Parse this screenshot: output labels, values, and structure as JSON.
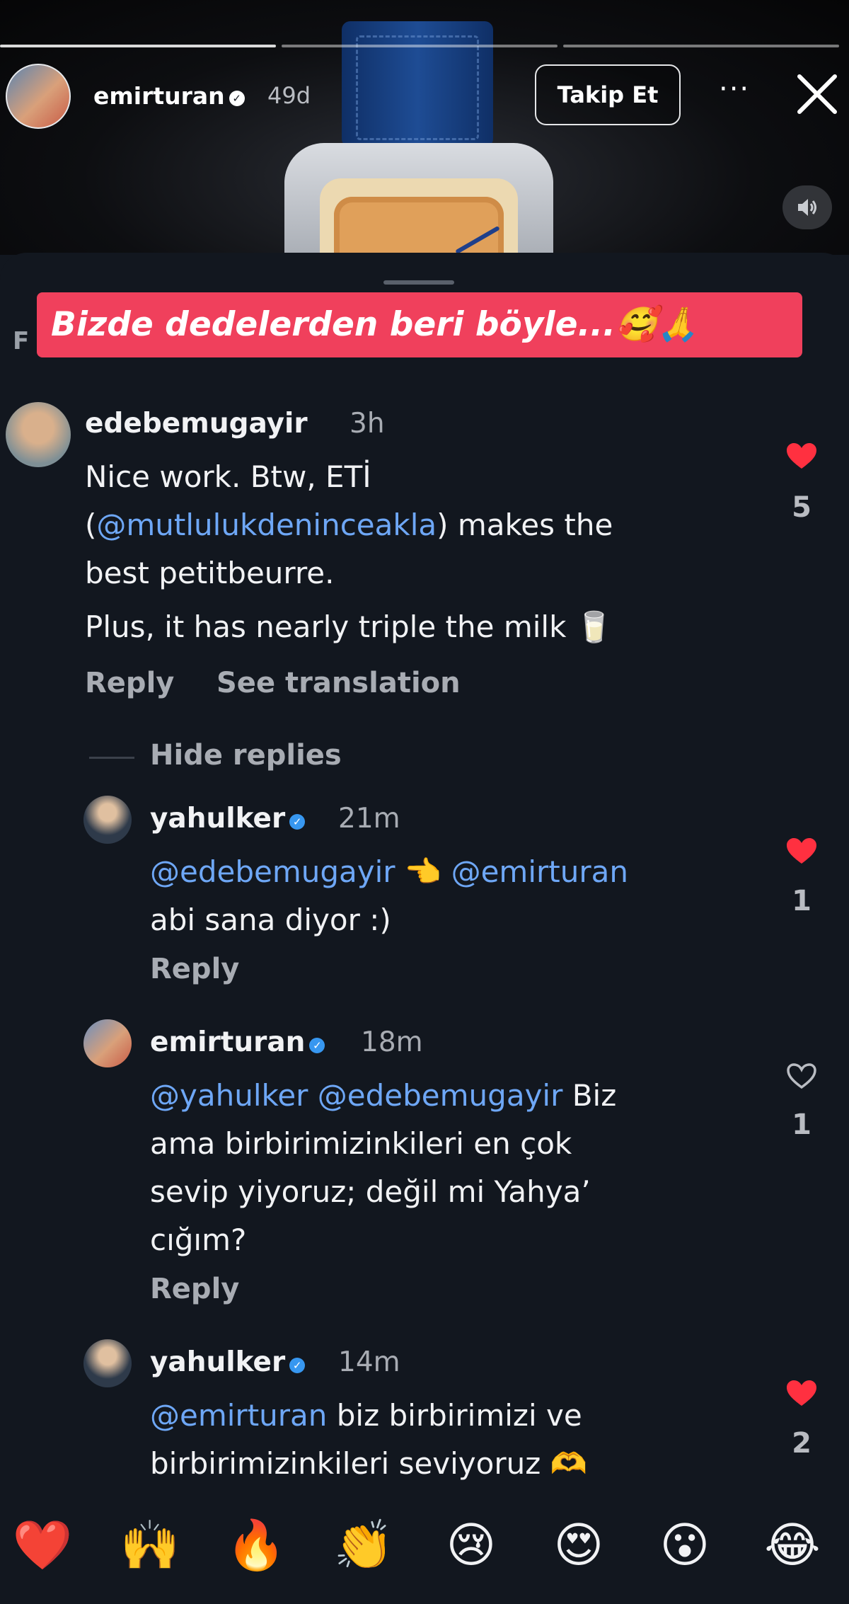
{
  "story": {
    "username": "emirturan",
    "time": "49d",
    "follow_label": "Takip Et",
    "more_label": "···"
  },
  "banner": {
    "text": "Bizde dedelerden beri böyle...🥰🙏"
  },
  "sheet_peek": "F",
  "comments": [
    {
      "username": "edebemugayir",
      "time": "3h",
      "text_parts": [
        "Nice work. Btw, ETİ",
        "(",
        "@mutlulukdeninceakla",
        ") makes the",
        "best petitbeurre.",
        "Plus, it has nearly triple the milk 🥛"
      ],
      "actions": [
        "Reply",
        "See translation"
      ],
      "liked": true,
      "likes": "5"
    }
  ],
  "hide_replies_label": "Hide replies",
  "replies": [
    {
      "username": "yahulker",
      "time": "21m",
      "mention1": "@edebemugayir",
      "pointer": "👈",
      "mention2": "@emirturan",
      "text": "abi sana diyor :)",
      "reply_label": "Reply",
      "liked": true,
      "likes": "1"
    },
    {
      "username": "emirturan",
      "time": "18m",
      "mention1": "@yahulker",
      "mention2": "@edebemugayir",
      "text_inline": "Biz",
      "text_lines": "ama birbirimizinkileri en çok\nsevip yiyoruz; değil mi Yahya’\ncığım?",
      "reply_label": "Reply",
      "liked": false,
      "likes": "1"
    },
    {
      "username": "yahulker",
      "time": "14m",
      "mention1": "@emirturan",
      "text_inline": "biz birbirimizi ve",
      "text_line2": "birbirimizinkileri seviyoruz 🫶",
      "liked": true,
      "likes": "2"
    }
  ],
  "emoji_bar": [
    "❤️",
    "🙌",
    "🔥",
    "👏",
    "😢",
    "😍",
    "😮",
    "😂"
  ],
  "colors": {
    "background": "#12171f",
    "banner": "#f0405c",
    "mention": "#6ea7f6",
    "like": "#ff3040",
    "verified": "#3797f0"
  }
}
